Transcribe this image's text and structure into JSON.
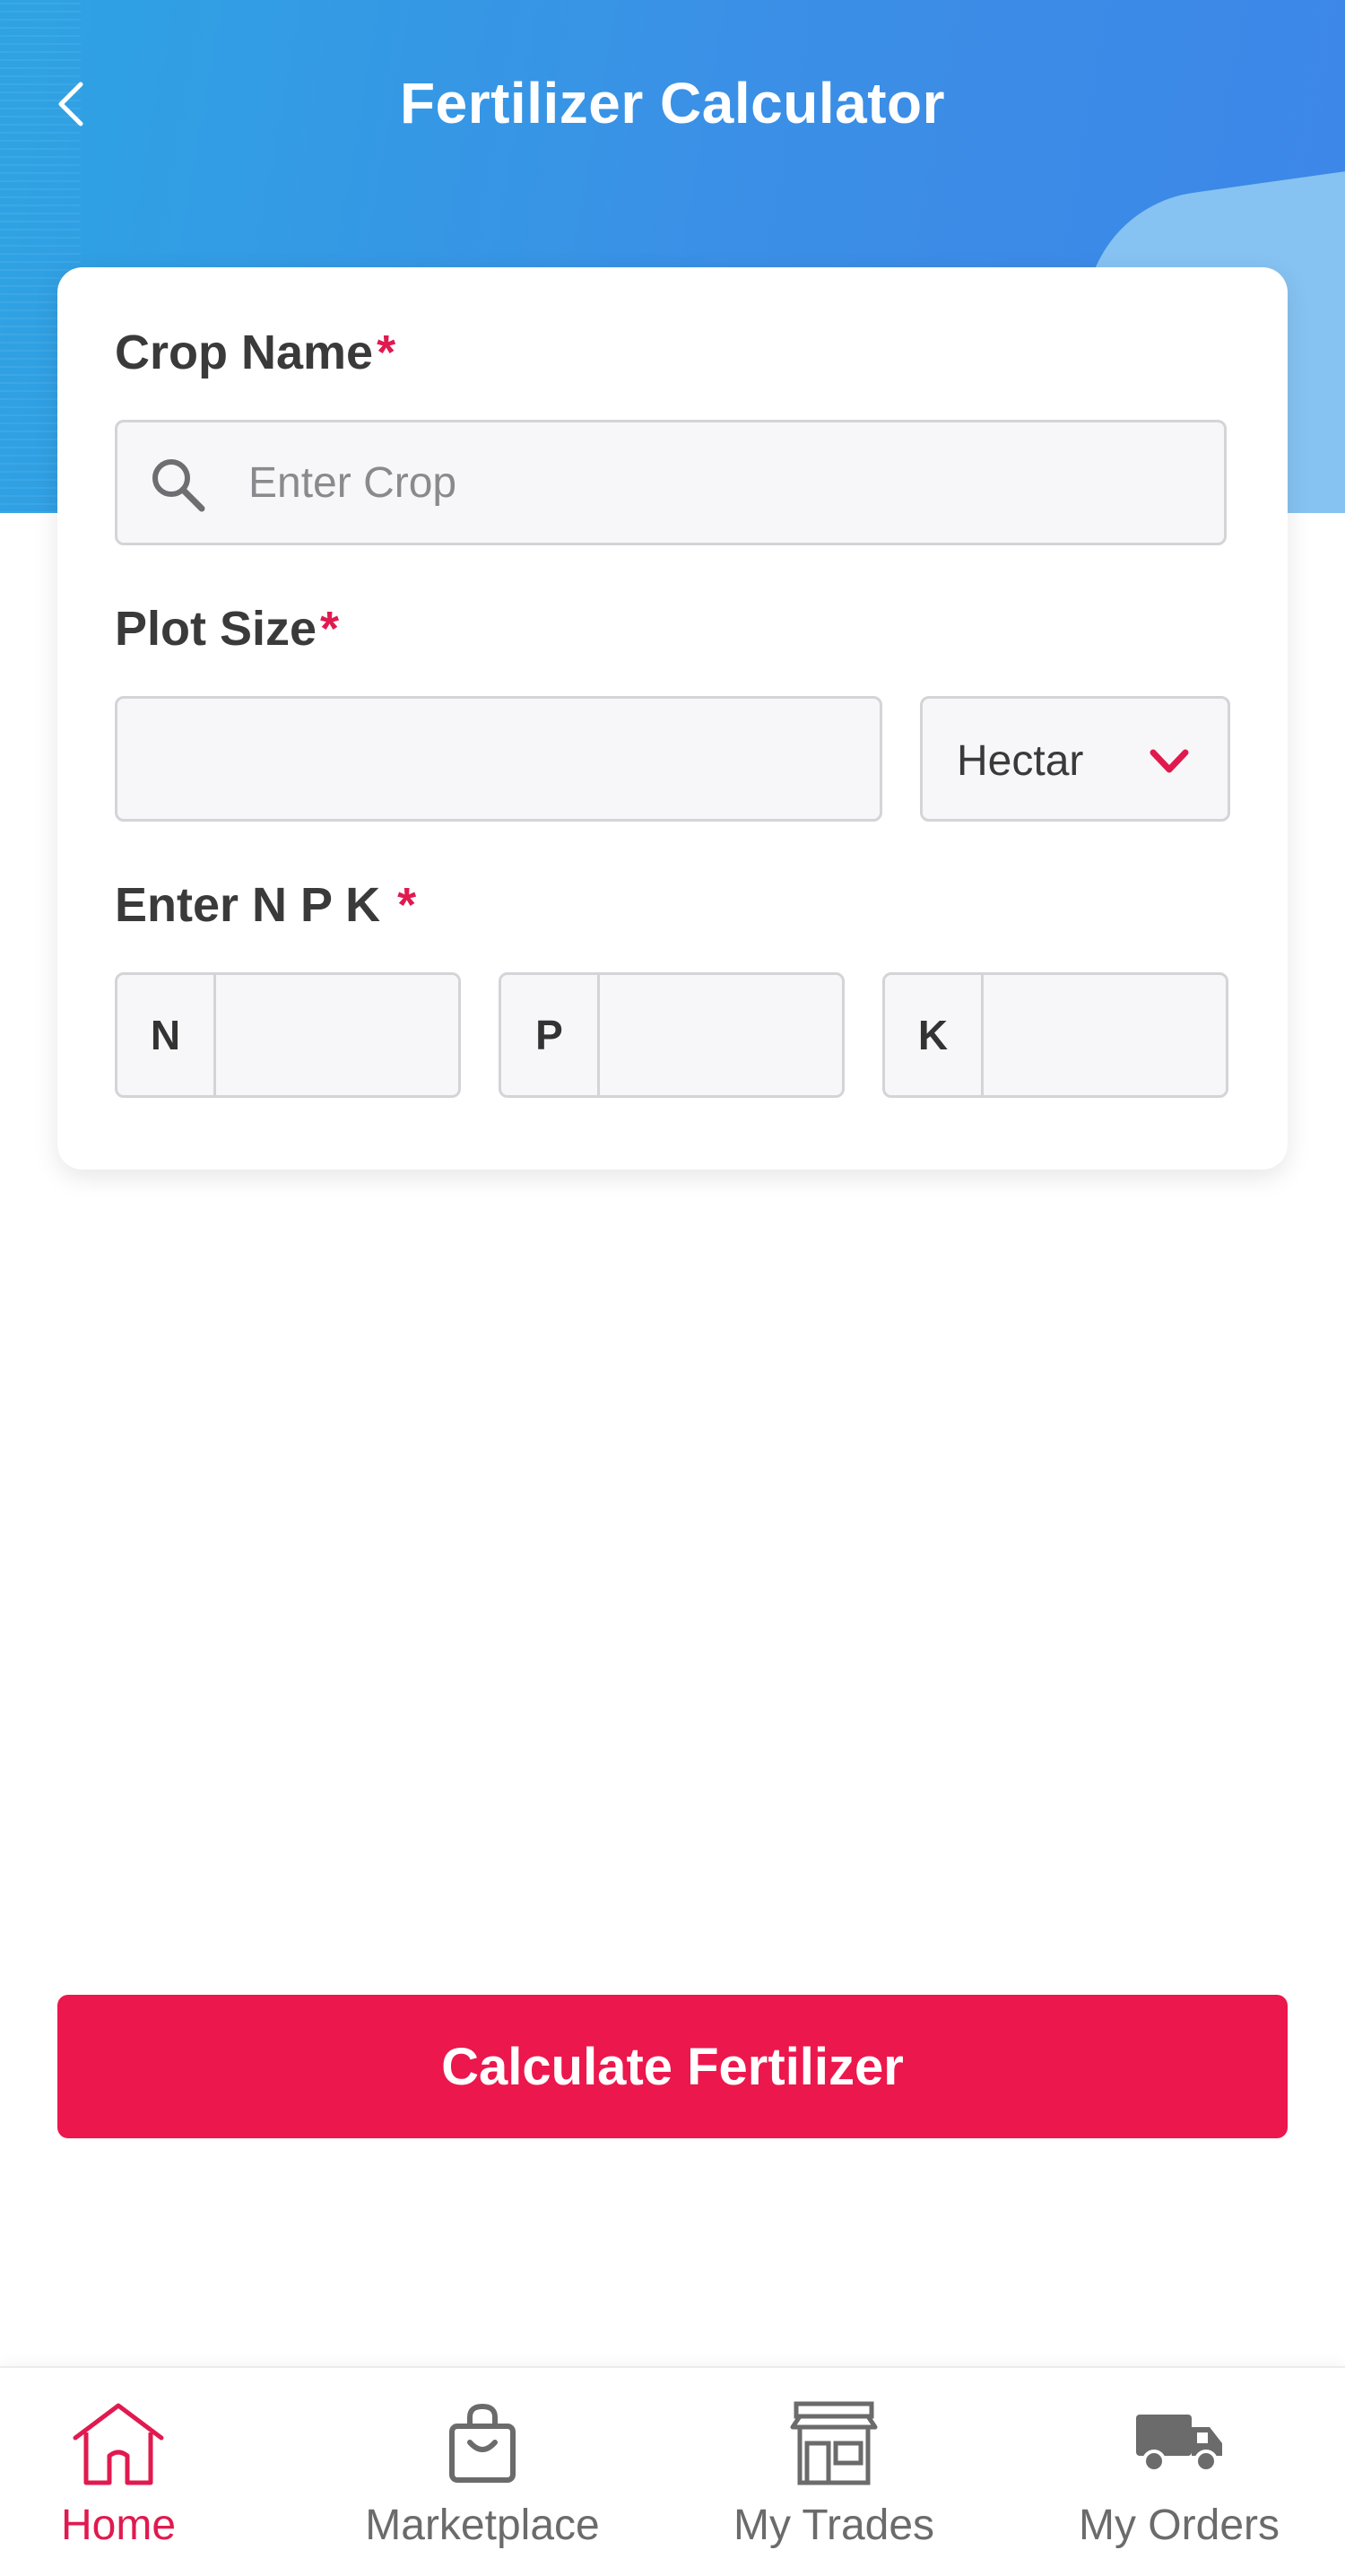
{
  "header": {
    "title": "Fertilizer Calculator",
    "back_icon": "chevron-left-icon"
  },
  "form": {
    "crop_name": {
      "label": "Crop Name",
      "required_mark": "*",
      "placeholder": "Enter Crop",
      "value": "",
      "icon": "search-icon"
    },
    "plot_size": {
      "label": "Plot Size",
      "required_mark": "*",
      "value": "",
      "unit": "Hectar",
      "unit_icon": "chevron-down-icon"
    },
    "npk": {
      "label": "Enter N P K ",
      "required_mark": "*",
      "fields": [
        {
          "prefix": "N",
          "value": ""
        },
        {
          "prefix": "P",
          "value": ""
        },
        {
          "prefix": "K",
          "value": ""
        }
      ]
    }
  },
  "actions": {
    "calculate_label": "Calculate Fertilizer"
  },
  "bottom_nav": {
    "items": [
      {
        "label": "Home",
        "icon": "home-icon",
        "active": true
      },
      {
        "label": "Marketplace",
        "icon": "shopping-bag-icon",
        "active": false
      },
      {
        "label": "My Trades",
        "icon": "storefront-icon",
        "active": false
      },
      {
        "label": "My Orders",
        "icon": "truck-icon",
        "active": false
      }
    ]
  },
  "colors": {
    "accent": "#ec174c",
    "header_start": "#2ea3e3",
    "header_end": "#3d86e8",
    "inactive_nav": "#6b6b6b"
  }
}
